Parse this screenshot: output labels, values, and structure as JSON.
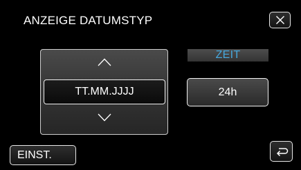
{
  "screen": {
    "title": "ANZEIGE DATUMSTYP"
  },
  "header": {
    "close_icon": "close-icon"
  },
  "date_format_picker": {
    "up_icon": "chevron-up-icon",
    "down_icon": "chevron-down-icon",
    "selected_value": "TT.MM.JJJJ"
  },
  "time_setting": {
    "label": "ZEIT",
    "value": "24h",
    "label_color": "#46a8dd"
  },
  "footer": {
    "settings_label": "EINST.",
    "back_icon": "return-icon"
  }
}
